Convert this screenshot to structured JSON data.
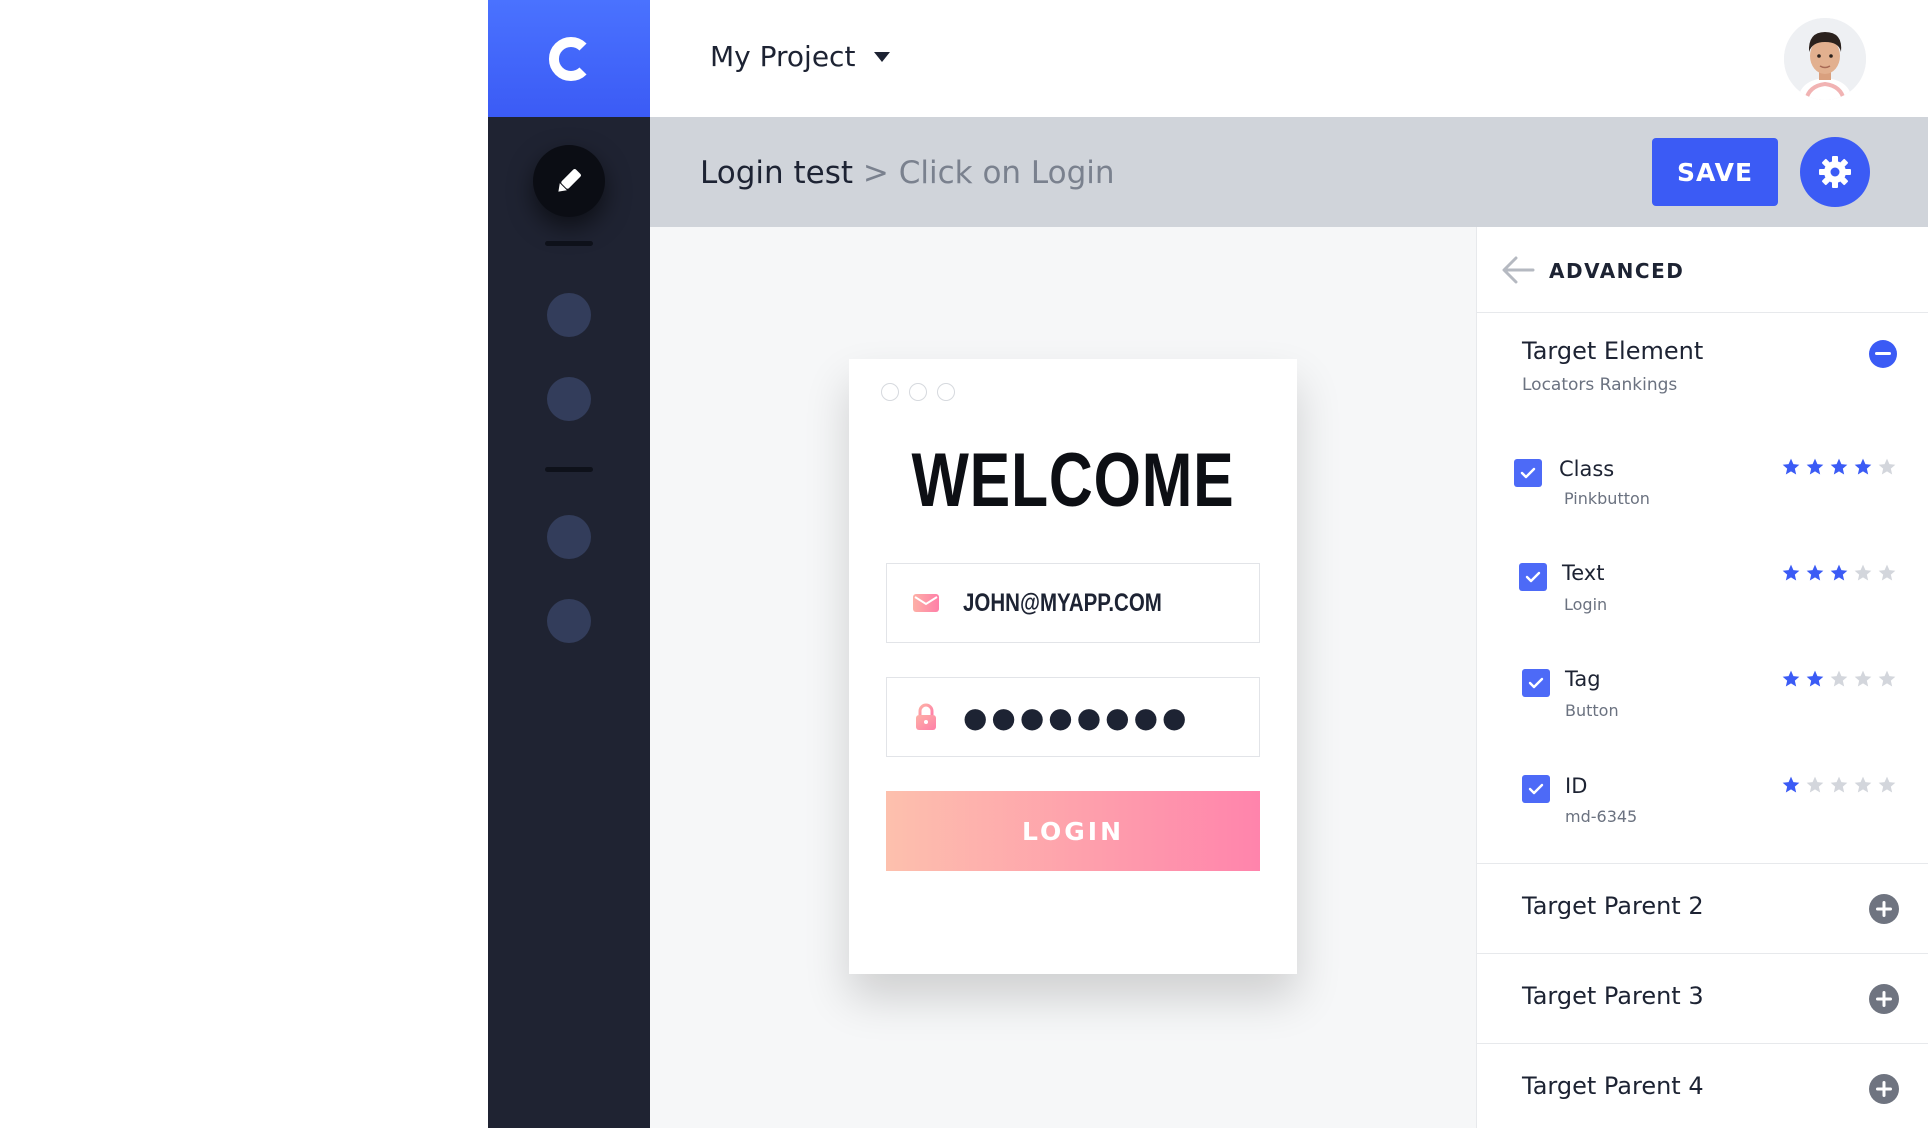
{
  "header": {
    "project_name": "My Project"
  },
  "titlebar": {
    "breadcrumb_root": "Login test",
    "breadcrumb_separator": ">",
    "breadcrumb_current": "Click on Login",
    "save_label": "SAVE"
  },
  "login_card": {
    "title": "WELCOME",
    "email_value": "JOHN@MYAPP.COM",
    "password_value": "●●●●●●●●",
    "login_label": "LOGIN"
  },
  "panel": {
    "title": "ADVANCED",
    "target_element": {
      "title": "Target Element",
      "subtitle": "Locators Rankings"
    },
    "locators": [
      {
        "name": "Class",
        "value": "Pinkbutton",
        "checked": true,
        "rating": 4,
        "max_rating": 5
      },
      {
        "name": "Text",
        "value": "Login",
        "checked": true,
        "rating": 3,
        "max_rating": 5
      },
      {
        "name": "Tag",
        "value": "Button",
        "checked": true,
        "rating": 2,
        "max_rating": 5
      },
      {
        "name": "ID",
        "value": "md-6345",
        "checked": true,
        "rating": 1,
        "max_rating": 5
      }
    ],
    "parents": [
      {
        "label": "Target Parent 2"
      },
      {
        "label": "Target Parent 3"
      },
      {
        "label": "Target Parent 4"
      }
    ]
  },
  "colors": {
    "accent": "#3b5bf5",
    "sidebar": "#1f2332",
    "star_active": "#3b5bf5",
    "star_inactive": "#d3d6dc",
    "login_gradient_start": "#fdc0ad",
    "login_gradient_end": "#ff84ac"
  },
  "icons": {
    "logo": "c-logo-icon",
    "edit": "pencil-icon",
    "dropdown": "caret-down-icon",
    "settings": "gear-icon",
    "back": "arrow-left-icon",
    "email": "envelope-icon",
    "password": "lock-icon",
    "collapse": "minus-circle-icon",
    "expand": "plus-circle-icon",
    "check": "check-icon",
    "star": "star-icon"
  }
}
